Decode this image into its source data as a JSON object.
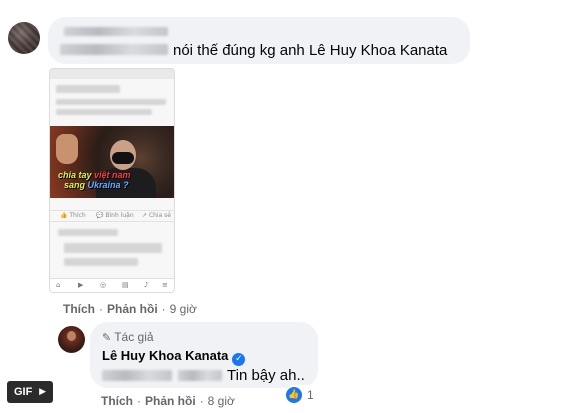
{
  "comment1": {
    "text": "nói thế đúng kg anh Lê Huy Khoa Kanata"
  },
  "screenshot": {
    "caption_line1_a": "chia tay ",
    "caption_line1_b": "việt nam",
    "caption_line2_a": "sang ",
    "caption_line2_b": "Ukraina ?",
    "action_like": "Thích",
    "action_comment": "Bình luận",
    "action_share": "Chia sẻ"
  },
  "comment1_actions": {
    "like_label": "Thích",
    "reply_label": "Phản hồi",
    "separator": "·",
    "time": "9 giờ"
  },
  "reply": {
    "author_badge": "Tác giả",
    "name": "Lê Huy Khoa Kanata",
    "verified_icon": "verified-badge-icon",
    "text": "Tin bậy ah..",
    "reaction_count": "1"
  },
  "reply_actions": {
    "like_label": "Thích",
    "reply_label": "Phản hồi",
    "separator": "·",
    "time": "8 giờ"
  },
  "gif_button": {
    "label": "GIF",
    "play_icon": "▶"
  },
  "colors": {
    "bubble": "#f0f2f5",
    "meta_text": "#65676b",
    "accent_blue": "#1877f2"
  }
}
